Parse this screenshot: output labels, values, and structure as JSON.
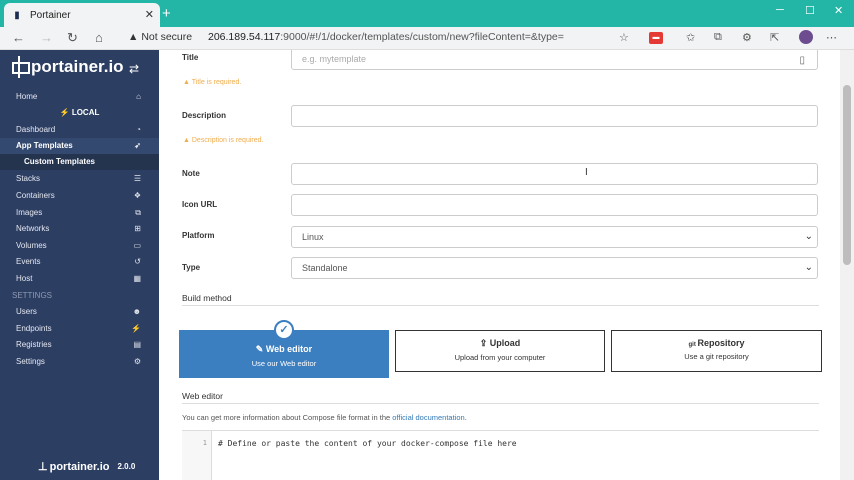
{
  "browser": {
    "tab_title": "Portainer",
    "security_label": "Not secure",
    "url_host": "206.189.54.117",
    "url_rest": ":9000/#!/1/docker/templates/custom/new?fileContent=&type="
  },
  "sidebar": {
    "brand": "portainer.io",
    "home": "Home",
    "endpoint": "LOCAL",
    "items": [
      {
        "label": "Dashboard"
      },
      {
        "label": "App Templates"
      },
      {
        "label": "Custom Templates"
      },
      {
        "label": "Stacks"
      },
      {
        "label": "Containers"
      },
      {
        "label": "Images"
      },
      {
        "label": "Networks"
      },
      {
        "label": "Volumes"
      },
      {
        "label": "Events"
      },
      {
        "label": "Host"
      }
    ],
    "settings_header": "SETTINGS",
    "settings_items": [
      {
        "label": "Users"
      },
      {
        "label": "Endpoints"
      },
      {
        "label": "Registries"
      },
      {
        "label": "Settings"
      }
    ],
    "footer_brand": "portainer.io",
    "version": "2.0.0"
  },
  "form": {
    "title_label": "Title",
    "title_placeholder": "e.g. mytemplate",
    "title_error": "Title is required.",
    "description_label": "Description",
    "description_error": "Description is required.",
    "note_label": "Note",
    "icon_url_label": "Icon URL",
    "platform_label": "Platform",
    "platform_value": "Linux",
    "type_label": "Type",
    "type_value": "Standalone"
  },
  "build_method": {
    "title": "Build method",
    "options": [
      {
        "title": "Web editor",
        "subtitle": "Use our Web editor",
        "selected": true
      },
      {
        "title": "Upload",
        "subtitle": "Upload from your computer",
        "selected": false
      },
      {
        "title": "Repository",
        "subtitle": "Use a git repository",
        "selected": false
      }
    ]
  },
  "web_editor": {
    "title": "Web editor",
    "info_prefix": "You can get more information about Compose file format in the",
    "info_link": "official documentation",
    "info_suffix": ".",
    "line_number": "1",
    "code_line": "# Define or paste the content of your docker-compose file here"
  },
  "colors": {
    "sidebar_bg": "#2d3e63",
    "selected_method": "#3c7fc0",
    "warning": "#f0ad4e",
    "browser_accent": "#23b5a5"
  }
}
